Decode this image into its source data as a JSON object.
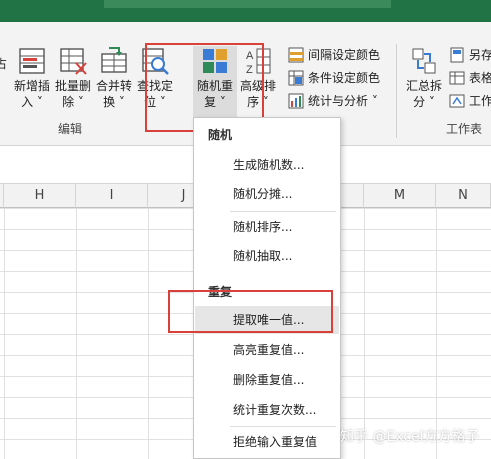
{
  "ribbon": {
    "left_cut_label": "占",
    "buttons": [
      {
        "line1": "新增插",
        "line2": "入 ˅"
      },
      {
        "line1": "批量删",
        "line2": "除 ˅"
      },
      {
        "line1": "合并转",
        "line2": "换 ˅"
      },
      {
        "line1": "查找定",
        "line2": "位 ˅"
      },
      {
        "line1": "随机重",
        "line2": "复 ˅"
      },
      {
        "line1": "高级排",
        "line2": "序 ˅"
      }
    ],
    "small_items": [
      {
        "label": "间隔设定颜色"
      },
      {
        "label": "条件设定颜色"
      },
      {
        "label": "统计与分析 ˅"
      }
    ],
    "right_buttons": [
      {
        "line1": "汇总拆",
        "line2": "分 ˅"
      }
    ],
    "right_small": [
      {
        "label": "另存"
      },
      {
        "label": "表格"
      },
      {
        "label": "工作"
      }
    ],
    "group_edit_label": "编辑",
    "group_sheet_label": "工作表"
  },
  "grid": {
    "columns": [
      "H",
      "I",
      "J",
      "M",
      "N"
    ]
  },
  "menu": {
    "section1_title": "随机",
    "section1_items": [
      "生成随机数...",
      "随机分摊..."
    ],
    "section1b_items": [
      "随机排序...",
      "随机抽取..."
    ],
    "section2_title": "重复",
    "section2_items": [
      "提取唯一值...",
      "高亮重复值...",
      "删除重复值...",
      "统计重复次数..."
    ],
    "section2b_items": [
      "拒绝输入重复值"
    ],
    "active_item": "提取唯一值..."
  },
  "watermark": "知乎 @Excel方方格子",
  "colors": {
    "title_green": "#217346",
    "highlight_red": "#d9403a",
    "ribbon_bg": "#f3f3f3"
  }
}
